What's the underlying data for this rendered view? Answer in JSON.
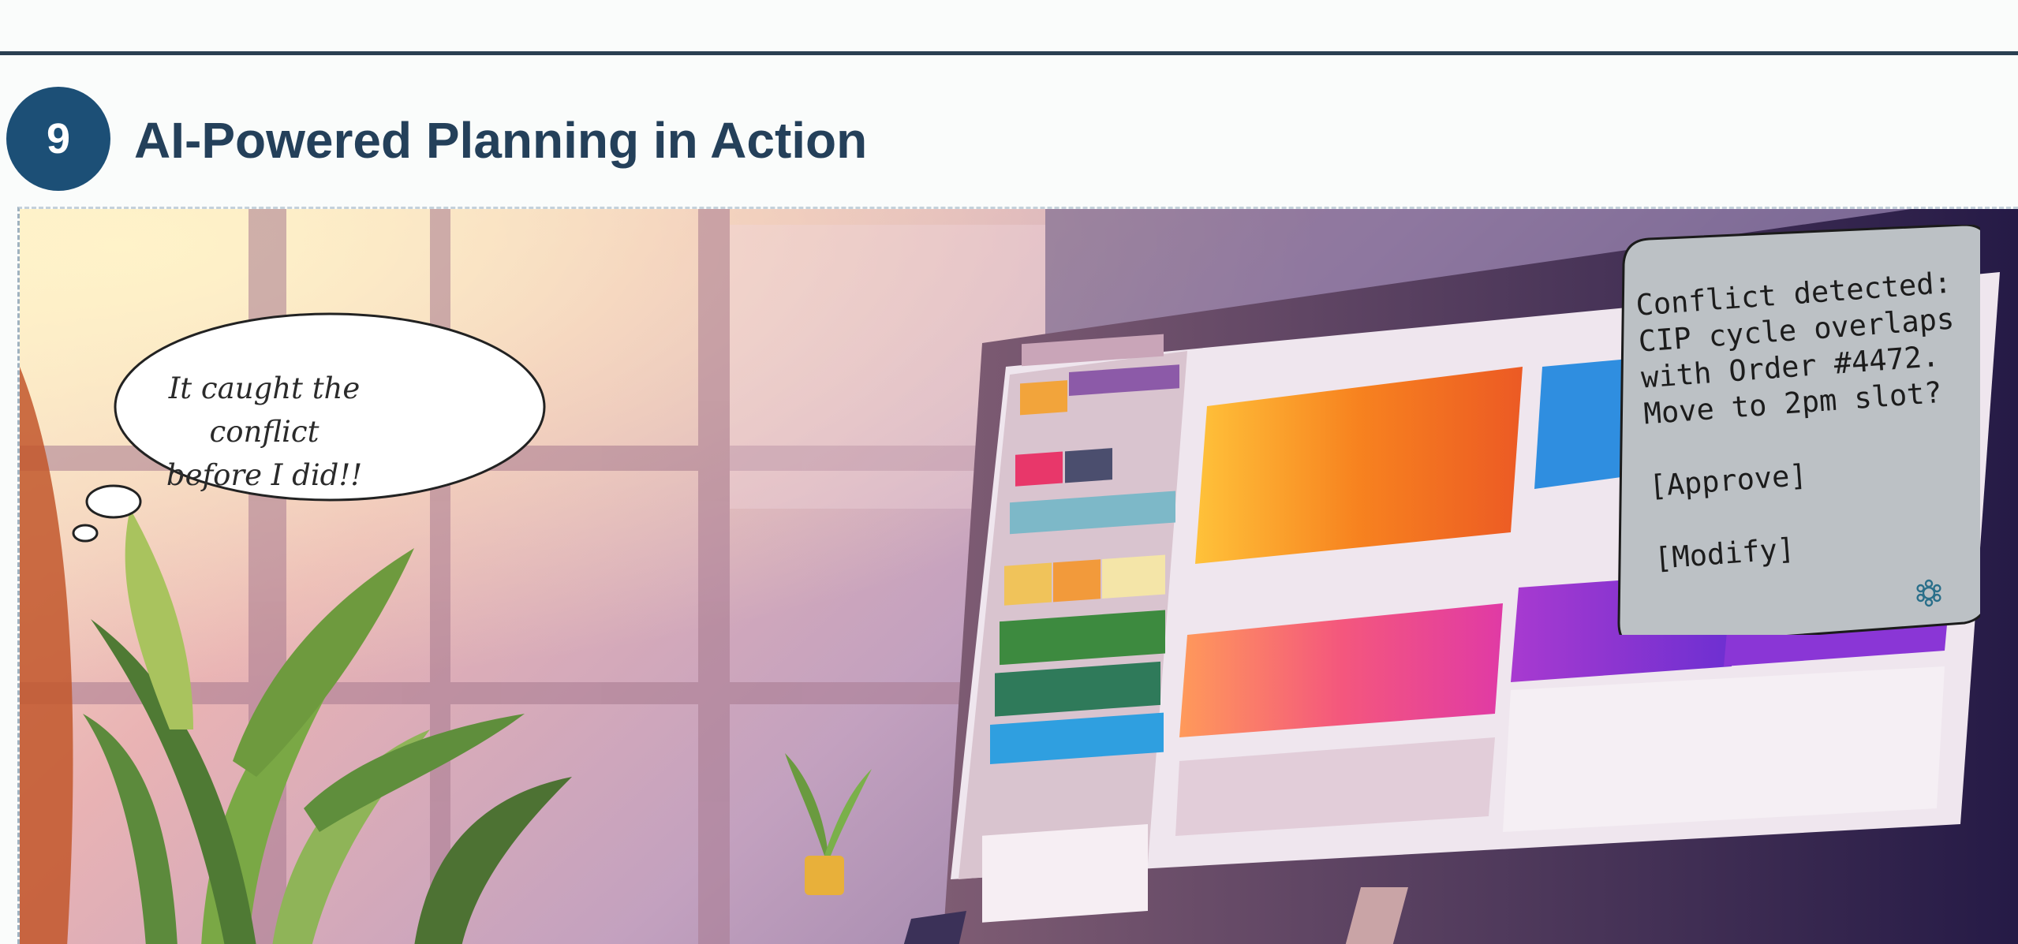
{
  "slide": {
    "number": "9",
    "title": "AI-Powered Planning in Action"
  },
  "thought_bubble": {
    "line1": "It caught the conflict",
    "line2": "before I did!!"
  },
  "notification": {
    "line1": "Conflict detected:",
    "line2": "CIP cycle overlaps",
    "line3": "with Order #4472.",
    "line4": "Move to 2pm slot?",
    "approve": "[Approve]",
    "modify": "[Modify]",
    "icon": "gear-icon"
  },
  "colors": {
    "title": "#24405a",
    "badge": "#1c4f76",
    "rule": "#2a3f52",
    "panel": "#bcc1c5"
  }
}
